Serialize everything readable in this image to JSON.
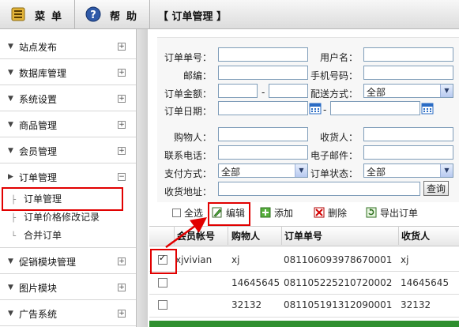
{
  "topbar": {
    "menu_label": "菜单",
    "help_label": "帮助",
    "page_title": "【 订单管理 】"
  },
  "sidebar": {
    "sections": [
      {
        "label": "站点发布",
        "toggle": "+"
      },
      {
        "label": "数据库管理",
        "toggle": "+"
      },
      {
        "label": "系统设置",
        "toggle": "+"
      },
      {
        "label": "商品管理",
        "toggle": "+"
      },
      {
        "label": "会员管理",
        "toggle": "+"
      },
      {
        "label": "订单管理",
        "toggle": "−"
      },
      {
        "label": "促销模块管理",
        "toggle": "+"
      },
      {
        "label": "图片模块",
        "toggle": "+"
      },
      {
        "label": "广告系统",
        "toggle": "+"
      }
    ],
    "order_subitems": [
      {
        "label": "订单管理"
      },
      {
        "label": "订单价格修改记录"
      },
      {
        "label": "合并订单"
      }
    ]
  },
  "form": {
    "order_no_label": "订单单号：",
    "username_label": "用户名：",
    "zip_label": "邮编：",
    "mobile_label": "手机号码：",
    "amount_label": "订单金额：",
    "amount_sep": "-",
    "shipping_label": "配送方式：",
    "shipping_value": "全部",
    "date_label": "订单日期：",
    "date_sep": "-",
    "buyer_label": "购物人：",
    "receiver_label": "收货人：",
    "phone_label": "联系电话：",
    "email_label": "电子邮件：",
    "payment_label": "支付方式：",
    "payment_value": "全部",
    "status_label": "订单状态：",
    "status_value": "全部",
    "address_label": "收货地址：",
    "search_button": "查询"
  },
  "toolbar": {
    "select_all": "全选",
    "edit": "编辑",
    "add": "添加",
    "delete": "删除",
    "export": "导出订单"
  },
  "table": {
    "headers": [
      "会员帐号",
      "购物人",
      "订单单号",
      "收货人"
    ],
    "rows": [
      {
        "checked": true,
        "member": "xjvivian",
        "buyer": "xj",
        "order_no": "081106093978670001",
        "receiver": "xj"
      },
      {
        "checked": false,
        "member": "",
        "buyer": "14645645",
        "order_no": "081105225210720002",
        "receiver": "14645645"
      },
      {
        "checked": false,
        "member": "",
        "buyer": "32132",
        "order_no": "081105191312090001",
        "receiver": "32132"
      }
    ]
  },
  "colors": {
    "highlight_red": "#e10000",
    "footer_green": "#2f8f2f"
  }
}
